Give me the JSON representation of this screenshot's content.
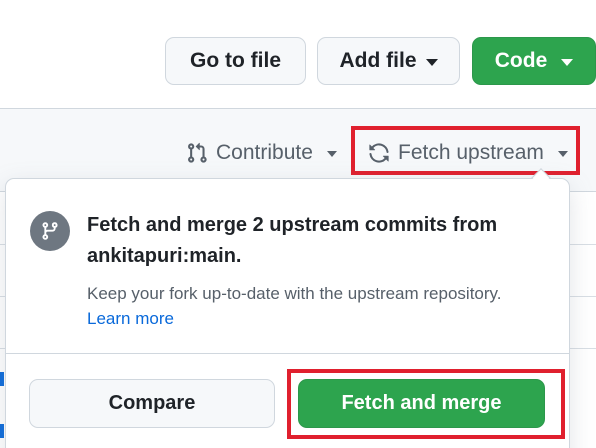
{
  "header": {
    "go_to_file_label": "Go to file",
    "add_file_label": "Add file",
    "code_label": "Code"
  },
  "toolbar": {
    "contribute_label": "Contribute",
    "fetch_upstream_label": "Fetch upstream"
  },
  "popover": {
    "title": "Fetch and merge 2 upstream commits from ankitapuri:main.",
    "description": "Keep your fork up-to-date with the upstream repository.",
    "learn_more_label": "Learn more",
    "compare_label": "Compare",
    "fetch_and_merge_label": "Fetch and merge"
  },
  "colors": {
    "primary_green": "#2da44e",
    "highlight_red": "#e0202e",
    "link_blue": "#0969da",
    "muted_text": "#57606a"
  },
  "icons": {
    "contribute": "git-pull-request-icon",
    "fetch_upstream": "sync-icon",
    "popover": "git-branch-icon"
  }
}
